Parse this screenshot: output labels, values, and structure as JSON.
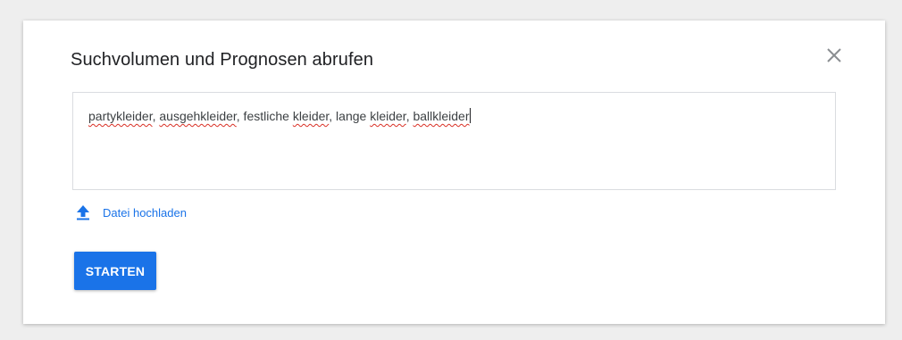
{
  "dialog": {
    "title": "Suchvolumen und Prognosen abrufen",
    "close_icon": "close-icon",
    "keywords_input": {
      "value": "partykleider, ausgehkleider, festliche kleider, lange kleider, ballkleider",
      "tokens": [
        {
          "text": "partykleider",
          "misspelled": true
        },
        {
          "text": ", ",
          "misspelled": false
        },
        {
          "text": "ausgehkleider",
          "misspelled": true
        },
        {
          "text": ", festliche ",
          "misspelled": false
        },
        {
          "text": "kleider",
          "misspelled": true
        },
        {
          "text": ", lange ",
          "misspelled": false
        },
        {
          "text": "kleider",
          "misspelled": true
        },
        {
          "text": ", ",
          "misspelled": false
        },
        {
          "text": "ballkleider",
          "misspelled": true
        }
      ]
    },
    "upload": {
      "icon": "upload-icon",
      "label": "Datei hochladen"
    },
    "start_button": {
      "label": "STARTEN"
    }
  },
  "colors": {
    "accent": "#1a73e8",
    "spellcheck": "#d93025",
    "background": "#eeeeee",
    "dialog": "#ffffff"
  }
}
